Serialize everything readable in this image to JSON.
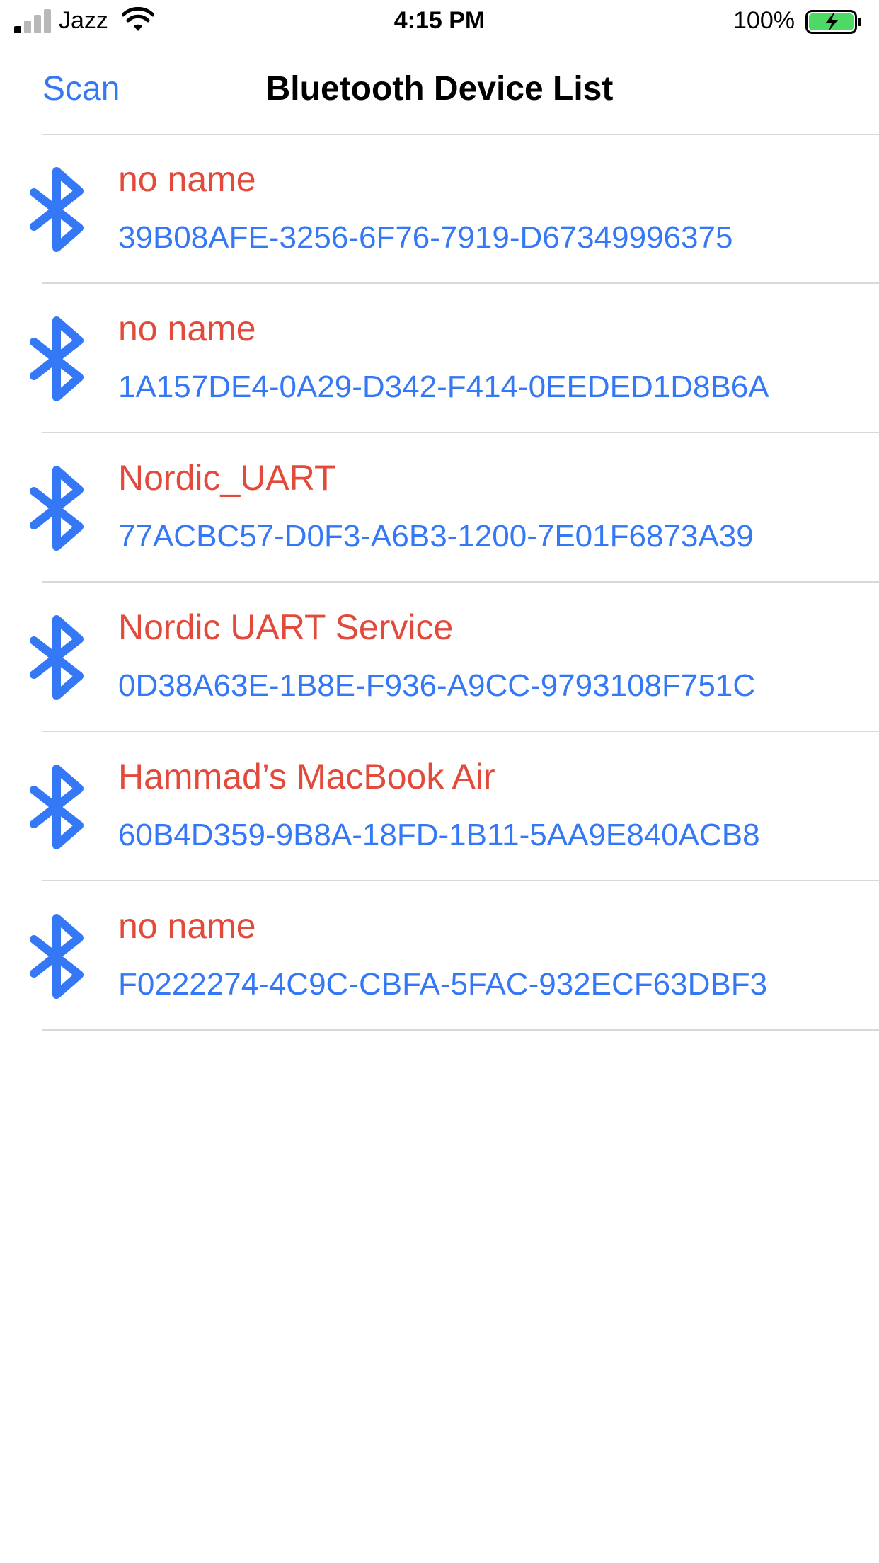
{
  "colors": {
    "accent": "#3478F6",
    "device_name": "#E24A3B",
    "separator": "#D9D9D9",
    "battery_fill": "#4CD964"
  },
  "status_bar": {
    "carrier": "Jazz",
    "time": "4:15 PM",
    "battery_percent": "100%",
    "signal_bars_active": 1,
    "signal_bars_total": 4,
    "battery_level": 1.0,
    "charging": true
  },
  "nav": {
    "scan_label": "Scan",
    "title": "Bluetooth Device List"
  },
  "devices": [
    {
      "name": "no name",
      "uuid": "39B08AFE-3256-6F76-7919-D67349996375",
      "icon": "bluetooth-icon"
    },
    {
      "name": "no name",
      "uuid": "1A157DE4-0A29-D342-F414-0EEDED1D8B6A",
      "icon": "bluetooth-icon"
    },
    {
      "name": "Nordic_UART",
      "uuid": "77ACBC57-D0F3-A6B3-1200-7E01F6873A39",
      "icon": "bluetooth-icon"
    },
    {
      "name": "Nordic UART Service",
      "uuid": "0D38A63E-1B8E-F936-A9CC-9793108F751C",
      "icon": "bluetooth-icon"
    },
    {
      "name": "Hammad’s MacBook Air",
      "uuid": "60B4D359-9B8A-18FD-1B11-5AA9E840ACB8",
      "icon": "bluetooth-icon"
    },
    {
      "name": "no name",
      "uuid": "F0222274-4C9C-CBFA-5FAC-932ECF63DBF3",
      "icon": "bluetooth-icon"
    }
  ]
}
